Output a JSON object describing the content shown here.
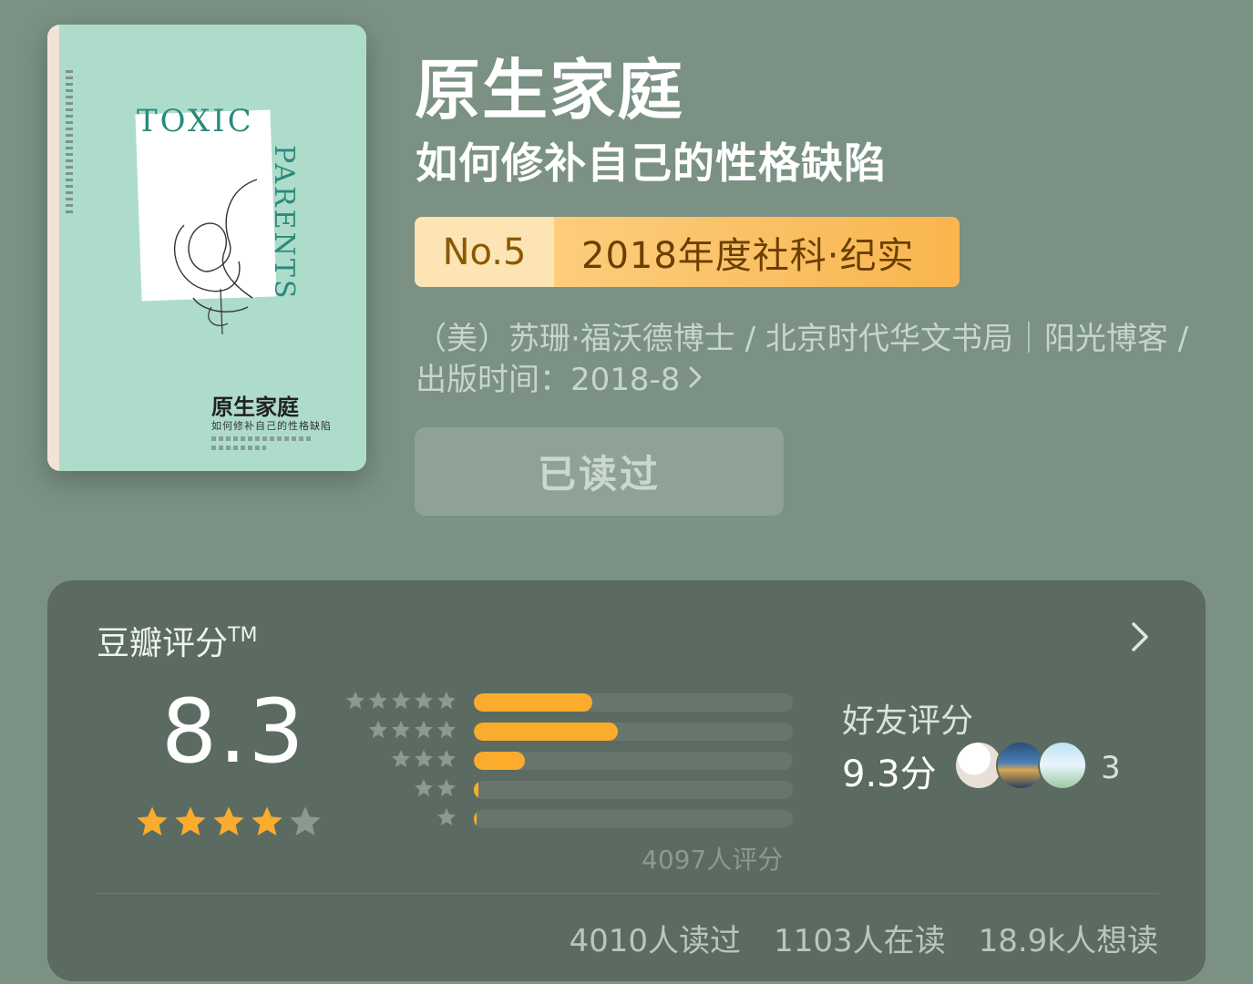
{
  "book": {
    "title": "原生家庭",
    "subtitle": "如何修补自己的性格缺陷",
    "rank": {
      "number": "No.5",
      "label": "2018年度社科·纪实"
    },
    "meta_line": "（美）苏珊·福沃德博士 / 北京时代华文书局｜阳光博客 / 出版时间：2018-8",
    "read_button": "已读过"
  },
  "cover": {
    "title_en_1": "TOXIC",
    "title_en_2": "PARENTS",
    "title_cn": "原生家庭",
    "subtitle_cn": "如何修补自己的性格缺陷"
  },
  "rating": {
    "header": "豆瓣评分",
    "trademark": "TM",
    "score": "8.3",
    "star_level": 4,
    "distribution": [
      {
        "stars": 5,
        "fraction": 0.37
      },
      {
        "stars": 4,
        "fraction": 0.45
      },
      {
        "stars": 3,
        "fraction": 0.16
      },
      {
        "stars": 2,
        "fraction": 0.015
      },
      {
        "stars": 1,
        "fraction": 0.005
      }
    ],
    "count_text": "4097人评分",
    "friend_label": "好友评分",
    "friend_score": "9.3分",
    "friend_count": "3",
    "stats": {
      "read": "4010人读过",
      "reading": "1103人在读",
      "want": "18.9k人想读"
    }
  },
  "colors": {
    "background": "#7a9184",
    "card": "#5b6b61",
    "star": "#fbac2c",
    "star_empty": "#8b9a91",
    "badge_accent": "#f9b54e"
  }
}
